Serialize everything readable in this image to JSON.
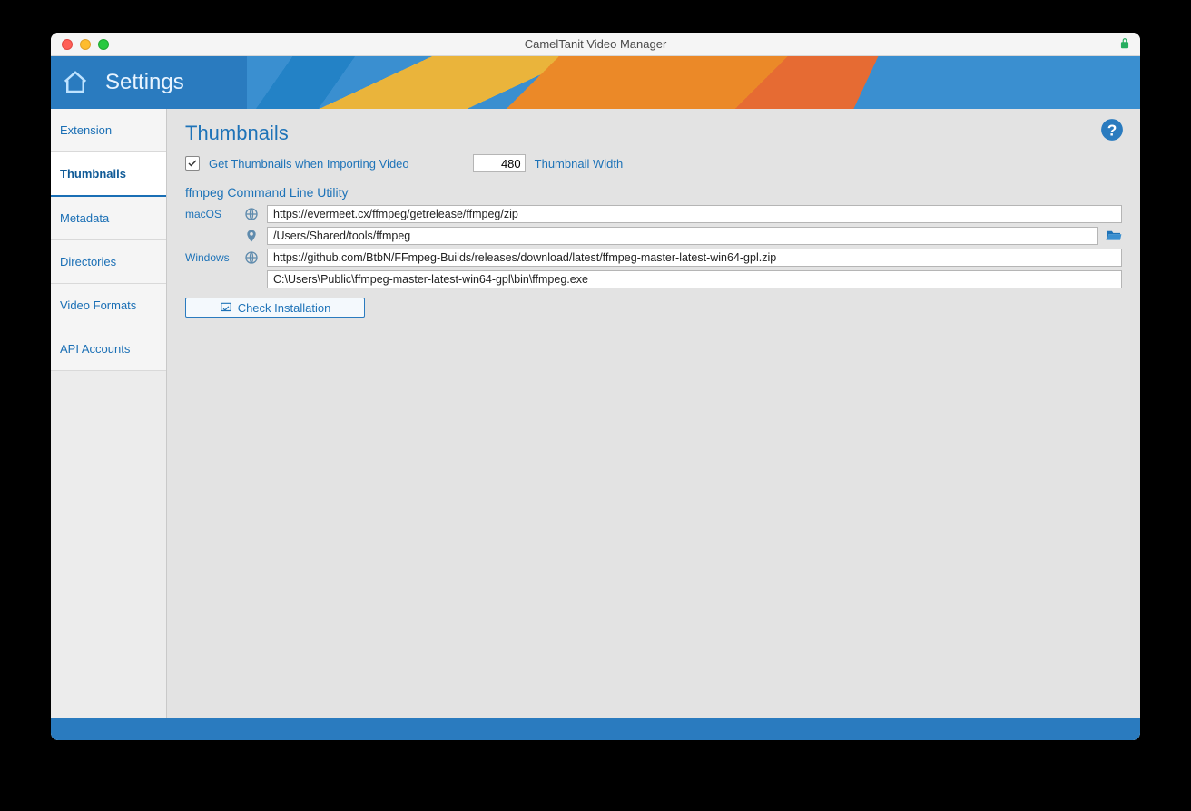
{
  "window": {
    "title": "CamelTanit Video Manager"
  },
  "banner": {
    "title": "Settings"
  },
  "sidebar": {
    "items": [
      {
        "label": "Extension"
      },
      {
        "label": "Thumbnails"
      },
      {
        "label": "Metadata"
      },
      {
        "label": "Directories"
      },
      {
        "label": "Video Formats"
      },
      {
        "label": "API Accounts"
      }
    ],
    "active_index": 1
  },
  "content": {
    "title": "Thumbnails",
    "import_checkbox_label": "Get Thumbnails when Importing Video",
    "import_checked": true,
    "thumbnail_width_value": "480",
    "thumbnail_width_label": "Thumbnail Width",
    "ffmpeg_section": "ffmpeg Command Line Utility",
    "macos_label": "macOS",
    "macos_url": "https://evermeet.cx/ffmpeg/getrelease/ffmpeg/zip",
    "macos_path": "/Users/Shared/tools/ffmpeg",
    "windows_label": "Windows",
    "windows_url": "https://github.com/BtbN/FFmpeg-Builds/releases/download/latest/ffmpeg-master-latest-win64-gpl.zip",
    "windows_path": "C:\\Users\\Public\\ffmpeg-master-latest-win64-gpl\\bin\\ffmpeg.exe",
    "check_button": "Check Installation"
  }
}
